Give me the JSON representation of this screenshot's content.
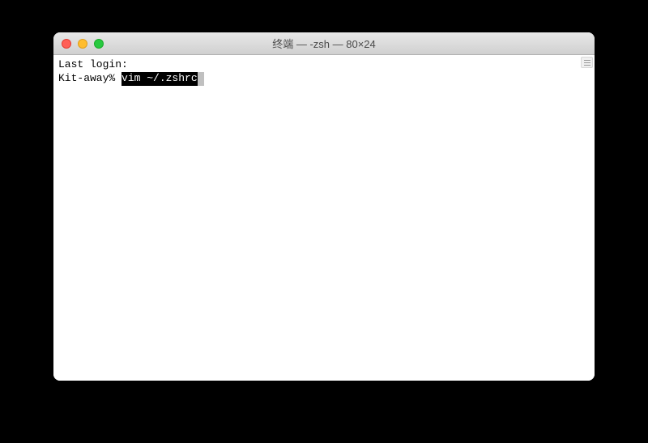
{
  "window": {
    "title": "终端 — -zsh — 80×24"
  },
  "terminal": {
    "line1": "Last login:",
    "prompt": "Kit-away% ",
    "command": "vim ~/.zshrc",
    "cursor": " "
  }
}
